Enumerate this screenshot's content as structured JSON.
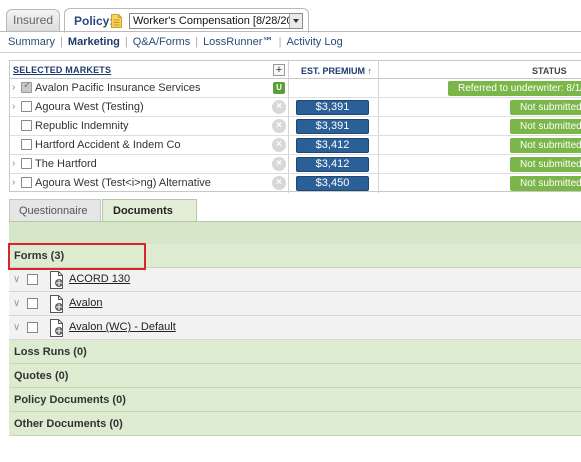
{
  "top_tabs": {
    "insured_label": "Insured",
    "policy_label": "Policy:",
    "policy_selected": "Worker's Compensation [8/28/2013]"
  },
  "subnav": {
    "items": [
      {
        "label": "Summary"
      },
      {
        "label": "Marketing"
      },
      {
        "label": "Q&A/Forms"
      },
      {
        "label": "LossRunner℠"
      },
      {
        "label": "Activity Log"
      }
    ]
  },
  "markets": {
    "header_markets": "SELECTED MARKETS",
    "header_add": "+",
    "header_premium": "EST. PREMIUM ↑",
    "header_status": "STATUS",
    "rows": [
      {
        "name": "Avalon Pacific Insurance Services",
        "badge": "U",
        "premium": "",
        "status": "Referred to underwriter: 8/1/"
      },
      {
        "name": "Agoura West (Testing)",
        "premium": "$3,391",
        "status": "Not submitted ye"
      },
      {
        "name": "Republic Indemnity",
        "premium": "$3,391",
        "status": "Not submitted ye"
      },
      {
        "name": "Hartford Accident & Indem Co",
        "premium": "$3,412",
        "status": "Not submitted ye"
      },
      {
        "name": "The Hartford",
        "premium": "$3,412",
        "status": "Not submitted ye"
      },
      {
        "name": "Agoura West (Test<i>ng) Alternative",
        "premium": "$3,450",
        "status": "Not submitted ye"
      }
    ]
  },
  "doc_tabs": {
    "questionnaire": "Questionnaire",
    "documents": "Documents"
  },
  "documents": {
    "forms_header": "Forms (3)",
    "forms": [
      {
        "label": "ACORD 130"
      },
      {
        "label": "Avalon"
      },
      {
        "label": "Avalon (WC) - Default"
      }
    ],
    "loss_runs": "Loss Runs (0)",
    "quotes": "Quotes (0)",
    "policy_documents": "Policy Documents (0)",
    "other_documents": "Other Documents (0)"
  },
  "colors": {
    "premium_button": "#2b5f97",
    "status_green": "#7ab648",
    "panel_green": "#d6e6c8",
    "highlight_red": "#d9252a"
  }
}
